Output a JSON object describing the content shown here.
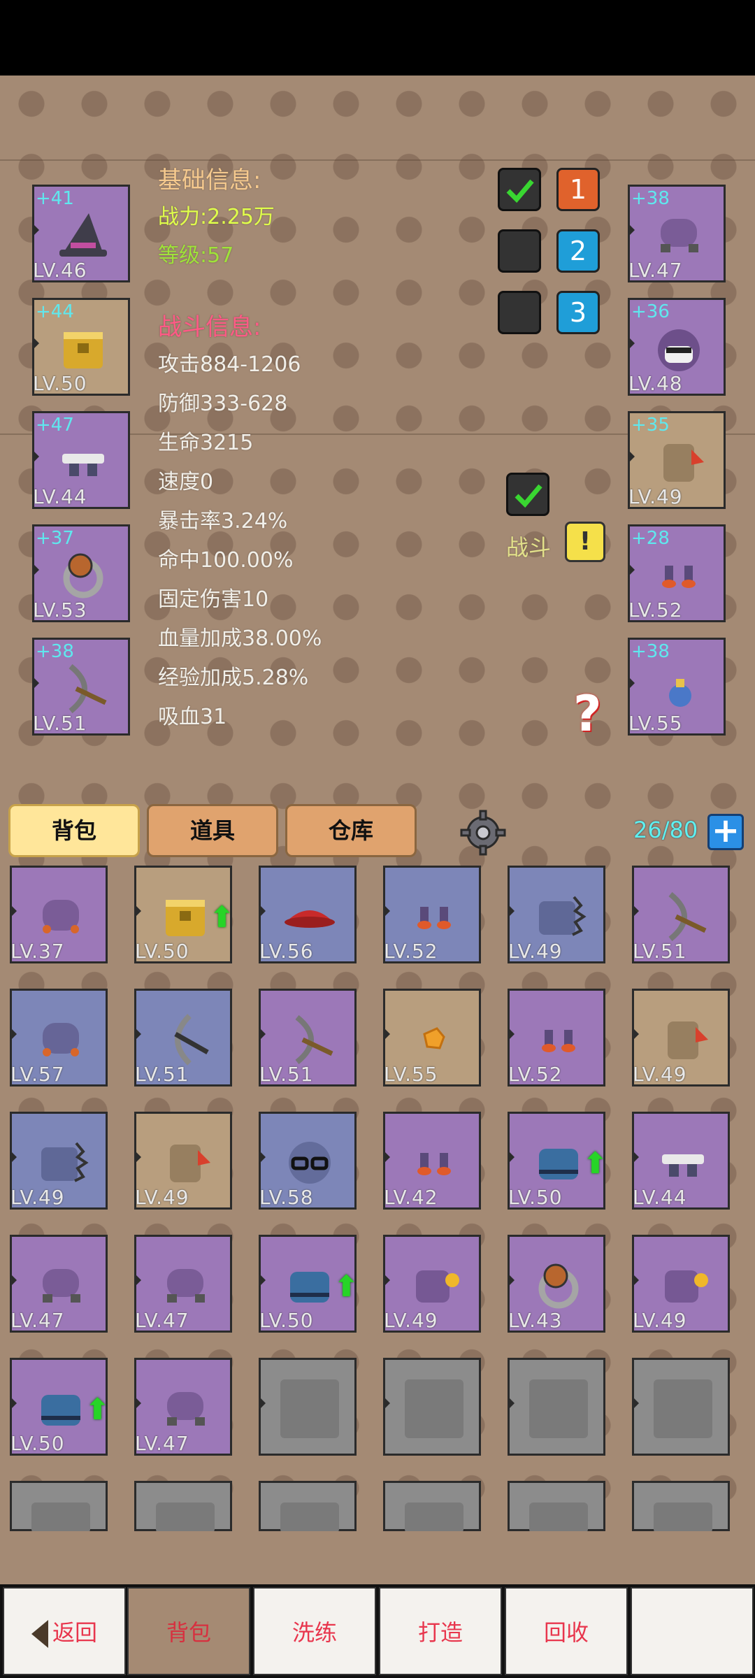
{
  "left_slots": [
    {
      "plus": "+41",
      "lv": "LV.46",
      "icon": "wizard-hat-icon",
      "color": "purple"
    },
    {
      "plus": "+44",
      "lv": "LV.50",
      "icon": "gold-armor-icon",
      "color": "tan"
    },
    {
      "plus": "+47",
      "lv": "LV.44",
      "icon": "white-skirt-icon",
      "color": "purple"
    },
    {
      "plus": "+37",
      "lv": "LV.53",
      "icon": "ring-icon",
      "color": "purple"
    },
    {
      "plus": "+38",
      "lv": "LV.51",
      "icon": "bow-icon",
      "color": "purple"
    }
  ],
  "right_slots": [
    {
      "plus": "+38",
      "lv": "LV.47",
      "icon": "gloves-icon",
      "color": "purple"
    },
    {
      "plus": "+36",
      "lv": "LV.48",
      "icon": "mask-icon",
      "color": "purple"
    },
    {
      "plus": "+35",
      "lv": "LV.49",
      "icon": "cape-icon",
      "color": "tan"
    },
    {
      "plus": "+28",
      "lv": "LV.52",
      "icon": "boots-icon",
      "color": "purple"
    },
    {
      "plus": "+38",
      "lv": "LV.55",
      "icon": "potion-icon",
      "color": "purple"
    }
  ],
  "basic": {
    "title": "基础信息:",
    "power": "战力:2.25万",
    "level": "等级:57"
  },
  "battle": {
    "title": "战斗信息:",
    "stats": [
      "攻击884-1206",
      "防御333-628",
      "生命3215",
      "速度0",
      "暴击率3.24%",
      "命中100.00%",
      "固定伤害10",
      "血量加成38.00%",
      "经验加成5.28%",
      "吸血31"
    ]
  },
  "loadouts": [
    {
      "label": "1",
      "checked": true,
      "color": "#e0622c"
    },
    {
      "label": "2",
      "checked": false,
      "color": "#1f9ed8"
    },
    {
      "label": "3",
      "checked": false,
      "color": "#1f9ed8"
    }
  ],
  "battle_toggle": {
    "label": "战斗",
    "checked": true
  },
  "tabs": [
    "背包",
    "道具",
    "仓库"
  ],
  "capacity": "26/80",
  "inventory": [
    {
      "lv": "LV.37",
      "color": "purple",
      "icon": "robe-icon",
      "up": false
    },
    {
      "lv": "LV.50",
      "color": "tan",
      "icon": "gold-armor-icon",
      "up": true
    },
    {
      "lv": "LV.56",
      "color": "blue",
      "icon": "red-hat-icon",
      "up": false
    },
    {
      "lv": "LV.52",
      "color": "blue",
      "icon": "boots-icon",
      "up": false
    },
    {
      "lv": "LV.49",
      "color": "blue",
      "icon": "spiky-armor-icon",
      "up": false
    },
    {
      "lv": "LV.51",
      "color": "purple",
      "icon": "bow-icon",
      "up": false
    },
    {
      "lv": "LV.57",
      "color": "blue",
      "icon": "robe-icon",
      "up": false
    },
    {
      "lv": "LV.51",
      "color": "blue",
      "icon": "crossbow-icon",
      "up": false
    },
    {
      "lv": "LV.51",
      "color": "purple",
      "icon": "bow-icon",
      "up": false
    },
    {
      "lv": "LV.55",
      "color": "tan",
      "icon": "gold-nugget-icon",
      "up": false
    },
    {
      "lv": "LV.52",
      "color": "purple",
      "icon": "boots-icon",
      "up": false
    },
    {
      "lv": "LV.49",
      "color": "tan",
      "icon": "cape-icon",
      "up": false
    },
    {
      "lv": "LV.49",
      "color": "blue",
      "icon": "spiky-armor-icon",
      "up": false
    },
    {
      "lv": "LV.49",
      "color": "tan",
      "icon": "cape-icon",
      "up": false
    },
    {
      "lv": "LV.58",
      "color": "blue",
      "icon": "glasses-icon",
      "up": false
    },
    {
      "lv": "LV.42",
      "color": "purple",
      "icon": "boots-icon",
      "up": false
    },
    {
      "lv": "LV.50",
      "color": "purple",
      "icon": "blue-jacket-icon",
      "up": true
    },
    {
      "lv": "LV.44",
      "color": "purple",
      "icon": "white-skirt-icon",
      "up": false
    },
    {
      "lv": "LV.47",
      "color": "purple",
      "icon": "gloves-icon",
      "up": false
    },
    {
      "lv": "LV.47",
      "color": "purple",
      "icon": "gloves-icon",
      "up": false
    },
    {
      "lv": "LV.50",
      "color": "purple",
      "icon": "blue-jacket-icon",
      "up": true
    },
    {
      "lv": "LV.49",
      "color": "purple",
      "icon": "fist-armor-icon",
      "up": false
    },
    {
      "lv": "LV.43",
      "color": "purple",
      "icon": "ring-icon",
      "up": false
    },
    {
      "lv": "LV.49",
      "color": "purple",
      "icon": "fist-armor-icon",
      "up": false
    },
    {
      "lv": "LV.50",
      "color": "purple",
      "icon": "blue-jacket-icon",
      "up": true
    },
    {
      "lv": "LV.47",
      "color": "purple",
      "icon": "gloves-icon",
      "up": false
    }
  ],
  "bottom_nav": [
    "返回",
    "背包",
    "洗练",
    "打造",
    "回收",
    ""
  ]
}
